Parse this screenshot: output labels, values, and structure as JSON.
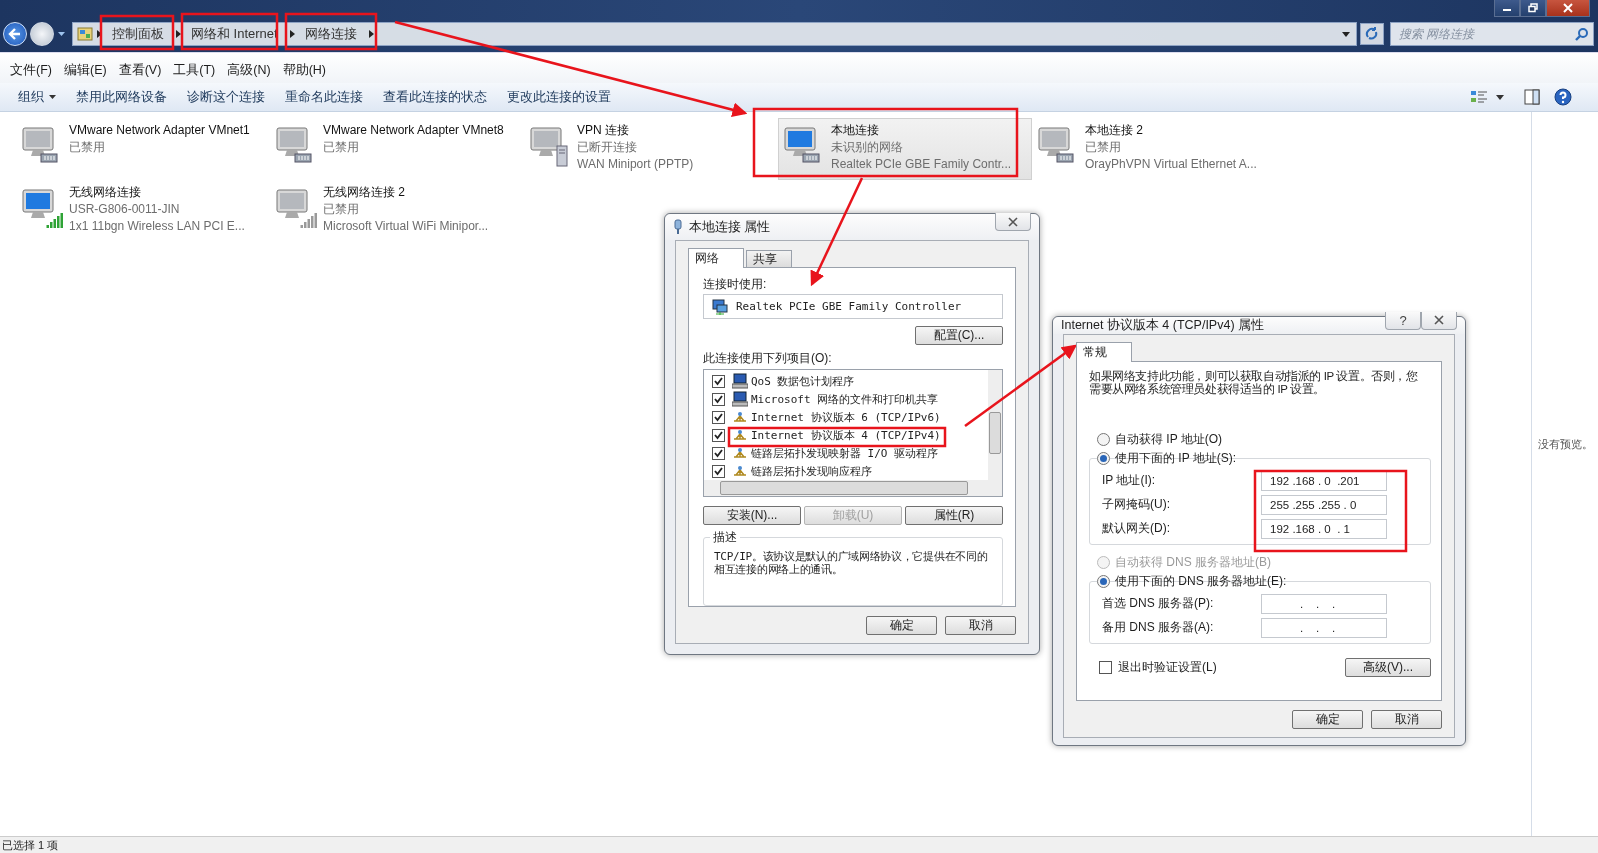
{
  "address_bar": {
    "breadcrumbs": [
      "控制面板",
      "网络和 Internet",
      "网络连接"
    ]
  },
  "search": {
    "placeholder": "搜索 网络连接"
  },
  "menu": [
    "文件(F)",
    "编辑(E)",
    "查看(V)",
    "工具(T)",
    "高级(N)",
    "帮助(H)"
  ],
  "toolbar": {
    "organize": "组织",
    "commands": [
      "禁用此网络设备",
      "诊断这个连接",
      "重命名此连接",
      "查看此连接的状态",
      "更改此连接的设置"
    ]
  },
  "connections": [
    {
      "name": "VMware Network Adapter VMnet1",
      "status": "已禁用",
      "kind": "wired",
      "active": false,
      "selected": false
    },
    {
      "name": "VMware Network Adapter VMnet8",
      "status": "已禁用",
      "kind": "wired",
      "active": false,
      "selected": false
    },
    {
      "name": "VPN 连接",
      "status": "已断开连接",
      "device": "WAN Miniport (PPTP)",
      "kind": "vpn",
      "active": false,
      "selected": false
    },
    {
      "name": "本地连接",
      "status": "未识别的网络",
      "device": "Realtek PCIe GBE Family Contr...",
      "kind": "wired",
      "active": true,
      "selected": true
    },
    {
      "name": "本地连接 2",
      "status": "已禁用",
      "device": "OrayPhVPN Virtual Ethernet A...",
      "kind": "wired",
      "active": false,
      "selected": false
    },
    {
      "name": "无线网络连接",
      "status": "USR-G806-0011-JIN",
      "device": "1x1 11bgn Wireless LAN PCI E...",
      "kind": "wireless",
      "active": true,
      "selected": false
    },
    {
      "name": "无线网络连接 2",
      "status": "已禁用",
      "device": "Microsoft Virtual WiFi Minipor...",
      "kind": "wireless",
      "active": false,
      "selected": false
    }
  ],
  "preview_pane": {
    "text": "没有预览。"
  },
  "status_bar": {
    "text": "已选择 1 项"
  },
  "properties_dialog": {
    "title": "本地连接 属性",
    "tabs": [
      {
        "label": "网络",
        "selected": true
      },
      {
        "label": "共享",
        "selected": false
      }
    ],
    "connect_using_label": "连接时使用:",
    "adapter": "Realtek PCIe GBE Family Controller",
    "configure_button": "配置(C)...",
    "items_label": "此连接使用下列项目(O):",
    "items": [
      {
        "label": "QoS 数据包计划程序",
        "checked": true,
        "kind": "service"
      },
      {
        "label": "Microsoft 网络的文件和打印机共享",
        "checked": true,
        "kind": "service"
      },
      {
        "label": "Internet 协议版本 6 (TCP/IPv6)",
        "checked": true,
        "kind": "protocol"
      },
      {
        "label": "Internet 协议版本 4 (TCP/IPv4)",
        "checked": true,
        "kind": "protocol"
      },
      {
        "label": "链路层拓扑发现映射器 I/O 驱动程序",
        "checked": true,
        "kind": "protocol"
      },
      {
        "label": "链路层拓扑发现响应程序",
        "checked": true,
        "kind": "protocol"
      }
    ],
    "buttons": [
      {
        "label": "安装(N)...",
        "disabled": false
      },
      {
        "label": "卸载(U)",
        "disabled": true
      },
      {
        "label": "属性(R)",
        "disabled": false
      }
    ],
    "description_title": "描述",
    "description": "TCP/IP。该协议是默认的广域网络协议，它提供在不同的相互连接的网络上的通讯。",
    "ok": "确定",
    "cancel": "取消"
  },
  "ipv4_dialog": {
    "title": "Internet 协议版本 4 (TCP/IPv4) 属性",
    "help_button": "?",
    "tabs": [
      {
        "label": "常规",
        "selected": true
      }
    ],
    "intro": "如果网络支持此功能，则可以获取自动指派的 IP 设置。否则，您需要从网络系统管理员处获得适当的 IP 设置。",
    "ip_modes": [
      {
        "label": "自动获得 IP 地址(O)",
        "selected": false,
        "disabled": false
      },
      {
        "label": "使用下面的 IP 地址(S):",
        "selected": true,
        "disabled": false
      }
    ],
    "ip_fields": [
      {
        "label": "IP 地址(I):",
        "value": "192 .168 . 0  .201"
      },
      {
        "label": "子网掩码(U):",
        "value": "255 .255 .255 . 0"
      },
      {
        "label": "默认网关(D):",
        "value": "192 .168 . 0  . 1"
      }
    ],
    "dns_modes": [
      {
        "label": "自动获得 DNS 服务器地址(B)",
        "selected": false,
        "disabled": true
      },
      {
        "label": "使用下面的 DNS 服务器地址(E):",
        "selected": true,
        "disabled": false
      }
    ],
    "dns_fields": [
      {
        "label": "首选 DNS 服务器(P):",
        "value": ".    .    ."
      },
      {
        "label": "备用 DNS 服务器(A):",
        "value": ".    .    ."
      }
    ],
    "validate": {
      "label": "退出时验证设置(L)",
      "checked": false
    },
    "advanced_button": "高级(V)...",
    "ok": "确定",
    "cancel": "取消"
  }
}
